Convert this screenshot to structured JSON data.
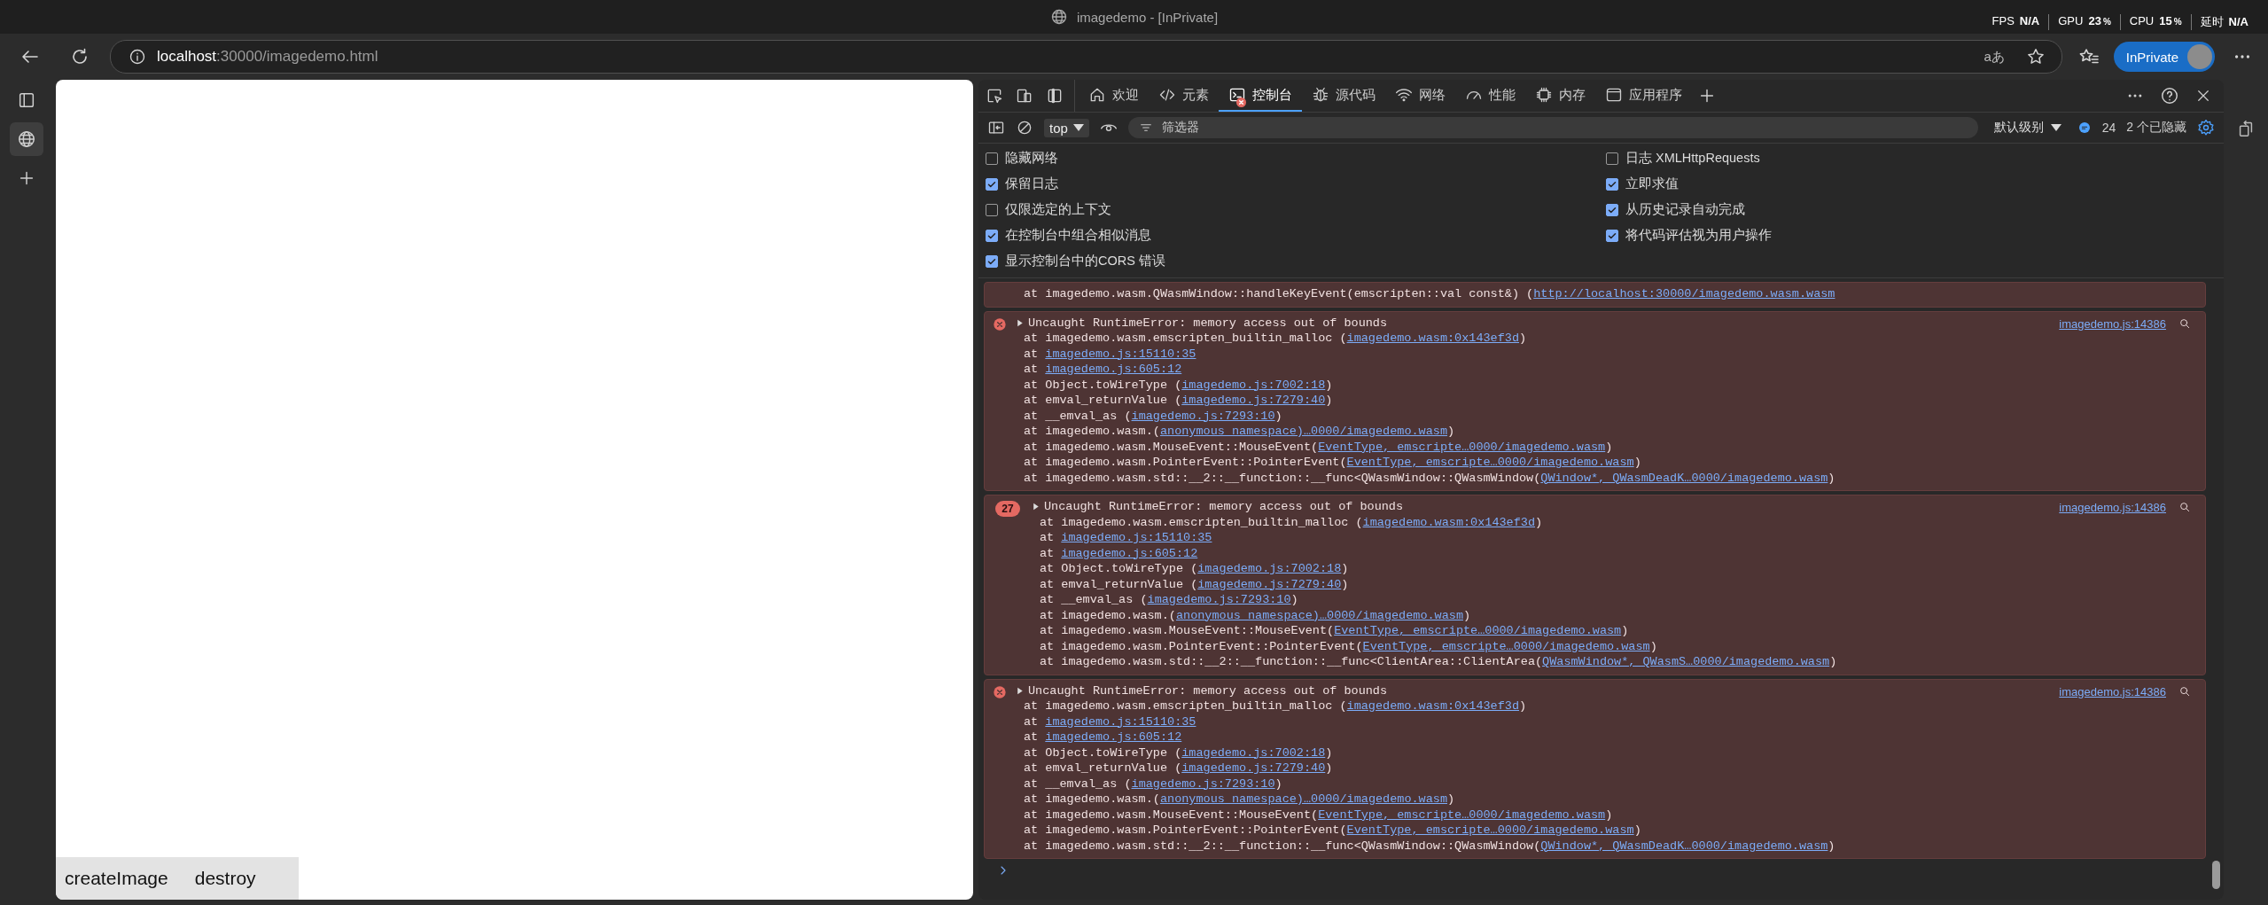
{
  "window": {
    "title": "imagedemo - [InPrivate]"
  },
  "perf": [
    {
      "label": "FPS",
      "value": "N/A"
    },
    {
      "label": "GPU",
      "value": "23",
      "unit": "%"
    },
    {
      "label": "CPU",
      "value": "15",
      "unit": "%"
    },
    {
      "label": "延时",
      "value": "N/A"
    }
  ],
  "address_bar": {
    "host": "localhost",
    "path": ":30000/imagedemo.html",
    "reader_glyph": "aあ"
  },
  "profile": {
    "label": "InPrivate"
  },
  "page": {
    "buttons": [
      "createImage",
      "destroy"
    ]
  },
  "devtools": {
    "tabs": [
      {
        "label": "欢迎",
        "selected": false,
        "error_badge": false
      },
      {
        "label": "元素",
        "selected": false,
        "error_badge": false
      },
      {
        "label": "控制台",
        "selected": true,
        "error_badge": true
      },
      {
        "label": "源代码",
        "selected": false,
        "error_badge": false
      },
      {
        "label": "网络",
        "selected": false,
        "error_badge": false
      },
      {
        "label": "性能",
        "selected": false,
        "error_badge": false
      },
      {
        "label": "内存",
        "selected": false,
        "error_badge": false
      },
      {
        "label": "应用程序",
        "selected": false,
        "error_badge": false
      }
    ],
    "toolbar": {
      "context": "top",
      "filter_placeholder": "筛选器",
      "level": "默认级别",
      "message_count": "24",
      "hidden": "2 个已隐藏"
    },
    "settings": {
      "left": [
        {
          "label": "隐藏网络",
          "checked": false
        },
        {
          "label": "保留日志",
          "checked": true
        },
        {
          "label": "仅限选定的上下文",
          "checked": false
        },
        {
          "label": "在控制台中组合相似消息",
          "checked": true
        },
        {
          "label": "显示控制台中的CORS 错误",
          "checked": true
        }
      ],
      "right": [
        {
          "label": "日志 XMLHttpRequests",
          "checked": false
        },
        {
          "label": "立即求值",
          "checked": true
        },
        {
          "label": "从历史记录自动完成",
          "checked": true
        },
        {
          "label": "将代码评估视为用户操作",
          "checked": true
        }
      ]
    },
    "messages": [
      {
        "kind": "trace_tail",
        "stack": [
          {
            "text": "at imagedemo.wasm.QWasmWindow::handleKeyEvent(emscripten::val const&) (",
            "link": "http://localhost:30000/imagedemo.wasm.wasm"
          }
        ]
      },
      {
        "kind": "error",
        "expanded": false,
        "text": "Uncaught RuntimeError: memory access out of bounds",
        "source": "imagedemo.js:14386",
        "stack": [
          {
            "text": "at imagedemo.wasm.emscripten_builtin_malloc (",
            "link": "imagedemo.wasm:0x143ef3d",
            "after": ")"
          },
          {
            "text": "at ",
            "link": "imagedemo.js:15110:35"
          },
          {
            "text": "at ",
            "link": "imagedemo.js:605:12"
          },
          {
            "text": "at Object.toWireType (",
            "link": "imagedemo.js:7002:18",
            "after": ")"
          },
          {
            "text": "at emval_returnValue (",
            "link": "imagedemo.js:7279:40",
            "after": ")"
          },
          {
            "text": "at __emval_as (",
            "link": "imagedemo.js:7293:10",
            "after": ")"
          },
          {
            "text": "at imagedemo.wasm.(",
            "link": "anonymous namespace)…0000/imagedemo.wasm",
            "after": ")"
          },
          {
            "text": "at imagedemo.wasm.MouseEvent::MouseEvent(",
            "link": "EventType, emscripte…0000/imagedemo.wasm",
            "after": ")"
          },
          {
            "text": "at imagedemo.wasm.PointerEvent::PointerEvent(",
            "link": "EventType, emscripte…0000/imagedemo.wasm",
            "after": ")"
          },
          {
            "text": "at imagedemo.wasm.std::__2::__function::__func<QWasmWindow::QWasmWindow(",
            "link": "QWindow*, QWasmDeadK…0000/imagedemo.wasm",
            "after": ")"
          }
        ]
      },
      {
        "kind": "error",
        "expanded": false,
        "count": "27",
        "text": "Uncaught RuntimeError: memory access out of bounds",
        "source": "imagedemo.js:14386",
        "stack": [
          {
            "text": "at imagedemo.wasm.emscripten_builtin_malloc (",
            "link": "imagedemo.wasm:0x143ef3d",
            "after": ")"
          },
          {
            "text": "at ",
            "link": "imagedemo.js:15110:35"
          },
          {
            "text": "at ",
            "link": "imagedemo.js:605:12"
          },
          {
            "text": "at Object.toWireType (",
            "link": "imagedemo.js:7002:18",
            "after": ")"
          },
          {
            "text": "at emval_returnValue (",
            "link": "imagedemo.js:7279:40",
            "after": ")"
          },
          {
            "text": "at __emval_as (",
            "link": "imagedemo.js:7293:10",
            "after": ")"
          },
          {
            "text": "at imagedemo.wasm.(",
            "link": "anonymous namespace)…0000/imagedemo.wasm",
            "after": ")"
          },
          {
            "text": "at imagedemo.wasm.MouseEvent::MouseEvent(",
            "link": "EventType, emscripte…0000/imagedemo.wasm",
            "after": ")"
          },
          {
            "text": "at imagedemo.wasm.PointerEvent::PointerEvent(",
            "link": "EventType, emscripte…0000/imagedemo.wasm",
            "after": ")"
          },
          {
            "text": "at imagedemo.wasm.std::__2::__function::__func<ClientArea::ClientArea(",
            "link": "QWasmWindow*, QWasmS…0000/imagedemo.wasm",
            "after": ")"
          }
        ]
      },
      {
        "kind": "error",
        "expanded": false,
        "text": "Uncaught RuntimeError: memory access out of bounds",
        "source": "imagedemo.js:14386",
        "stack": [
          {
            "text": "at imagedemo.wasm.emscripten_builtin_malloc (",
            "link": "imagedemo.wasm:0x143ef3d",
            "after": ")"
          },
          {
            "text": "at ",
            "link": "imagedemo.js:15110:35"
          },
          {
            "text": "at ",
            "link": "imagedemo.js:605:12"
          },
          {
            "text": "at Object.toWireType (",
            "link": "imagedemo.js:7002:18",
            "after": ")"
          },
          {
            "text": "at emval_returnValue (",
            "link": "imagedemo.js:7279:40",
            "after": ")"
          },
          {
            "text": "at __emval_as (",
            "link": "imagedemo.js:7293:10",
            "after": ")"
          },
          {
            "text": "at imagedemo.wasm.(",
            "link": "anonymous namespace)…0000/imagedemo.wasm",
            "after": ")"
          },
          {
            "text": "at imagedemo.wasm.MouseEvent::MouseEvent(",
            "link": "EventType, emscripte…0000/imagedemo.wasm",
            "after": ")"
          },
          {
            "text": "at imagedemo.wasm.PointerEvent::PointerEvent(",
            "link": "EventType, emscripte…0000/imagedemo.wasm",
            "after": ")"
          },
          {
            "text": "at imagedemo.wasm.std::__2::__function::__func<QWasmWindow::QWasmWindow(",
            "link": "QWindow*, QWasmDeadK…0000/imagedemo.wasm",
            "after": ")"
          }
        ]
      }
    ]
  }
}
